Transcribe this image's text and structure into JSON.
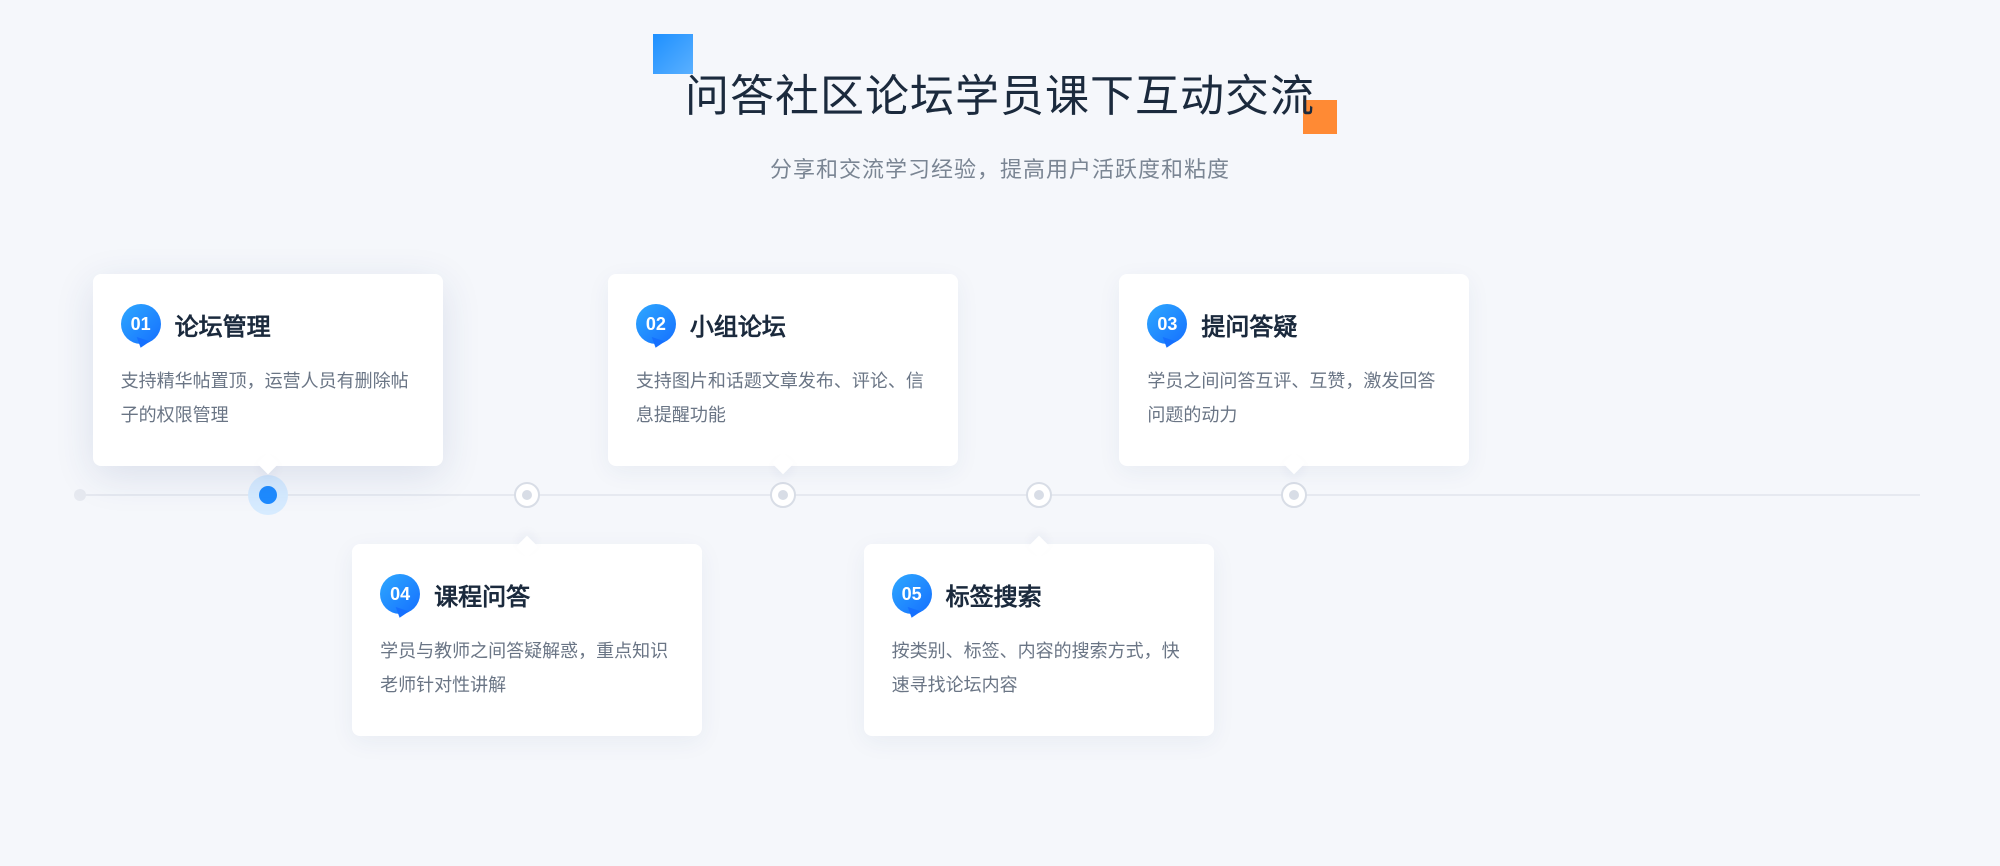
{
  "hero": {
    "title": "问答社区论坛学员课下互动交流",
    "subtitle": "分享和交流学习经验，提高用户活跃度和粘度"
  },
  "timeline": {
    "active_index": 0,
    "items": [
      {
        "num": "01",
        "title": "论坛管理",
        "desc": "支持精华帖置顶，运营人员有删除帖子的权限管理"
      },
      {
        "num": "02",
        "title": "小组论坛",
        "desc": "支持图片和话题文章发布、评论、信息提醒功能"
      },
      {
        "num": "03",
        "title": "提问答疑",
        "desc": "学员之间问答互评、互赞，激发回答问题的动力"
      },
      {
        "num": "04",
        "title": "课程问答",
        "desc": "学员与教师之间答疑解惑，重点知识老师针对性讲解"
      },
      {
        "num": "05",
        "title": "标签搜索",
        "desc": "按类别、标签、内容的搜索方式，快速寻找论坛内容"
      }
    ]
  },
  "colors": {
    "accent": "#1e8bff",
    "accent_gradient_start": "#2ea8ff",
    "accent_gradient_end": "#1570ff",
    "deco_orange": "#ff8a34"
  }
}
